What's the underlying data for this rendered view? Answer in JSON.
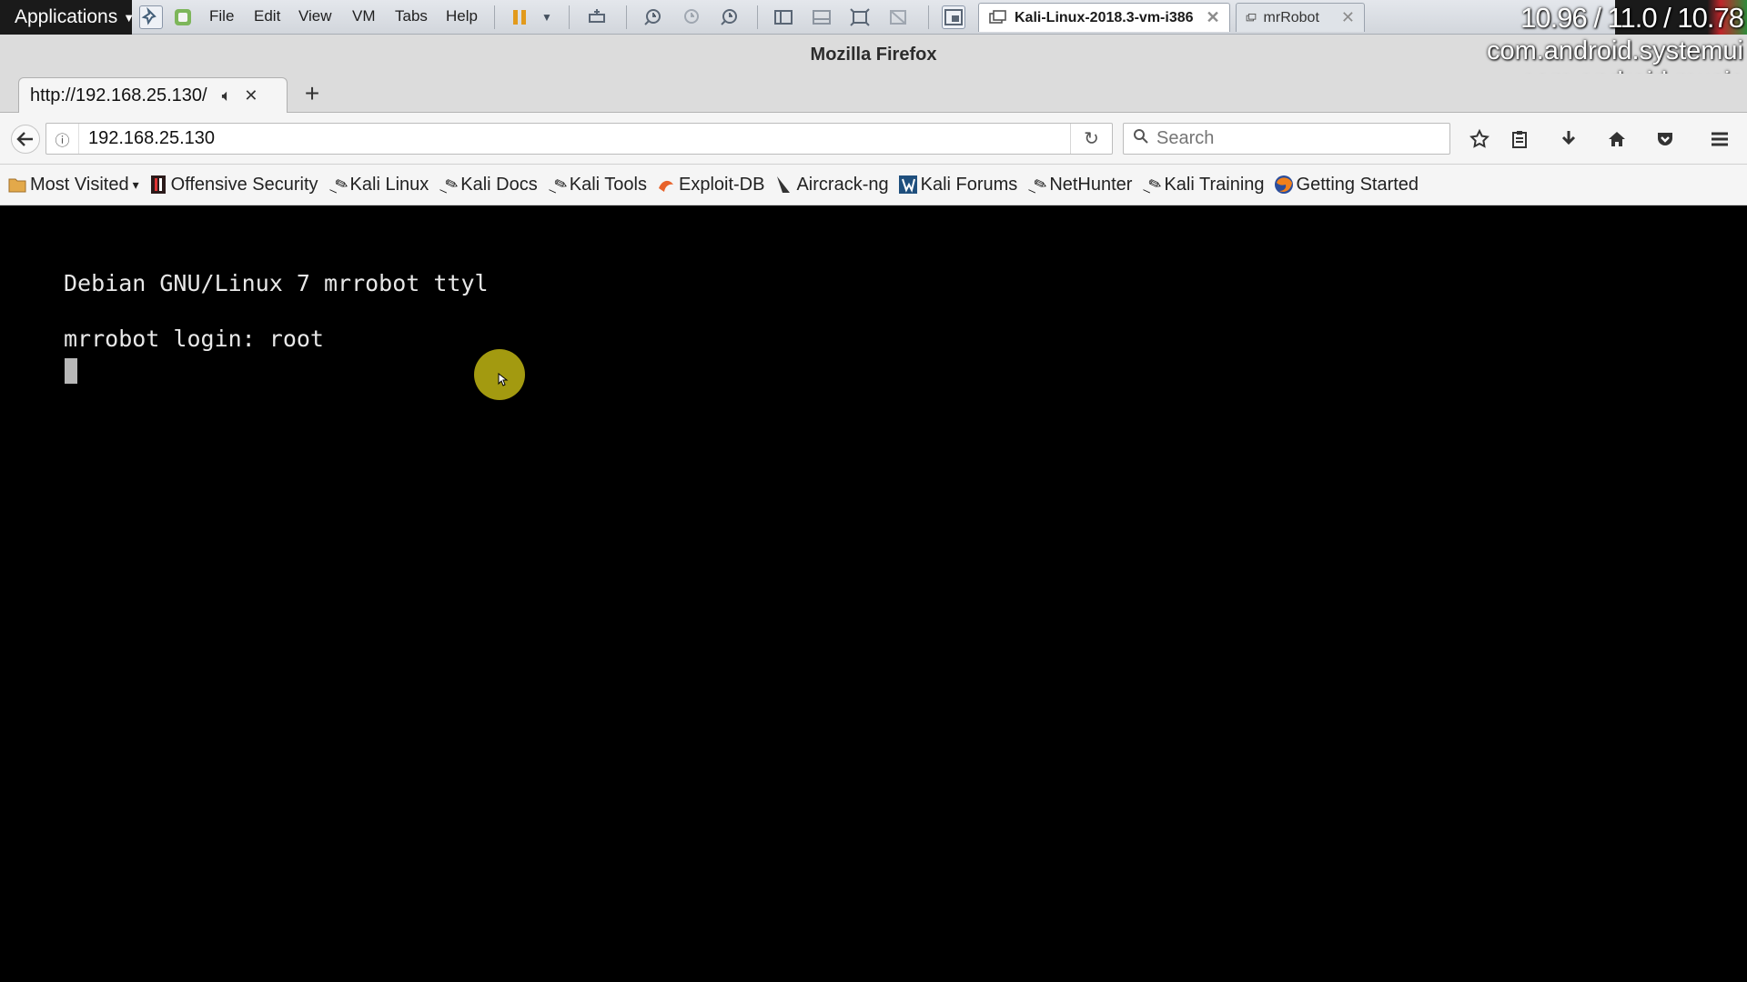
{
  "vmware": {
    "applications_label": "Applications",
    "menus": [
      "File",
      "Edit",
      "View",
      "VM",
      "Tabs",
      "Help"
    ],
    "tabs": [
      {
        "label": "Kali-Linux-2018.3-vm-i386",
        "active": true
      },
      {
        "label": "mrRobot",
        "active": false
      }
    ]
  },
  "overlay": {
    "load": "10.96 / 11.0 / 10.78",
    "process1": "com.android.systemui",
    "process2": "com.android.music"
  },
  "firefox": {
    "window_title": "Mozilla Firefox",
    "tab": {
      "label": "http://192.168.25.130/"
    },
    "new_tab_label": "+",
    "url": "192.168.25.130",
    "search_placeholder": "Search",
    "bookmarks": [
      {
        "label": "Most Visited",
        "icon": "folder-icon"
      },
      {
        "label": "Offensive Security",
        "icon": "offsec-icon"
      },
      {
        "label": "Kali Linux",
        "icon": "kali-dragon-icon"
      },
      {
        "label": "Kali Docs",
        "icon": "kali-dragon-icon"
      },
      {
        "label": "Kali Tools",
        "icon": "kali-dragon-icon"
      },
      {
        "label": "Exploit-DB",
        "icon": "exploitdb-icon"
      },
      {
        "label": "Aircrack-ng",
        "icon": "aircrack-icon"
      },
      {
        "label": "Kali Forums",
        "icon": "kali-forums-icon"
      },
      {
        "label": "NetHunter",
        "icon": "kali-dragon-icon"
      },
      {
        "label": "Kali Training",
        "icon": "kali-dragon-icon"
      },
      {
        "label": "Getting Started",
        "icon": "firefox-icon"
      }
    ]
  },
  "console": {
    "line1": "Debian GNU/Linux 7 mrrobot ttyl",
    "line2": "mrrobot login: root"
  },
  "colors": {
    "console_bg": "#000000",
    "console_fg": "#e8e8e8",
    "mouse_highlight": "#a39a10"
  }
}
